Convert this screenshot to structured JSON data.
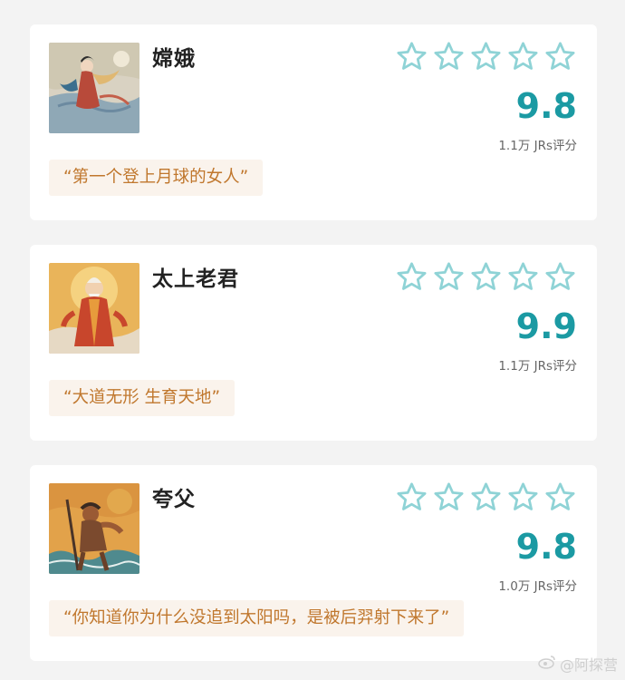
{
  "accent_color": "#1b9aa3",
  "star_outline_color": "#8fd3d6",
  "quote_text_color": "#c0772d",
  "quote_bg_color": "#faf3ec",
  "star_count_max": 5,
  "cards": [
    {
      "name": "嫦娥",
      "score": "9.8",
      "rating_count": "1.1万 JRs评分",
      "quote": "“第一个登上月球的女人”",
      "image_icon": "change-portrait-icon"
    },
    {
      "name": "太上老君",
      "score": "9.9",
      "rating_count": "1.1万 JRs评分",
      "quote": "“大道无形 生育天地”",
      "image_icon": "laojun-portrait-icon"
    },
    {
      "name": "夸父",
      "score": "9.8",
      "rating_count": "1.0万 JRs评分",
      "quote": "“你知道你为什么没追到太阳吗，是被后羿射下来了”",
      "image_icon": "kuafu-portrait-icon"
    }
  ],
  "watermark": "@阿探营"
}
